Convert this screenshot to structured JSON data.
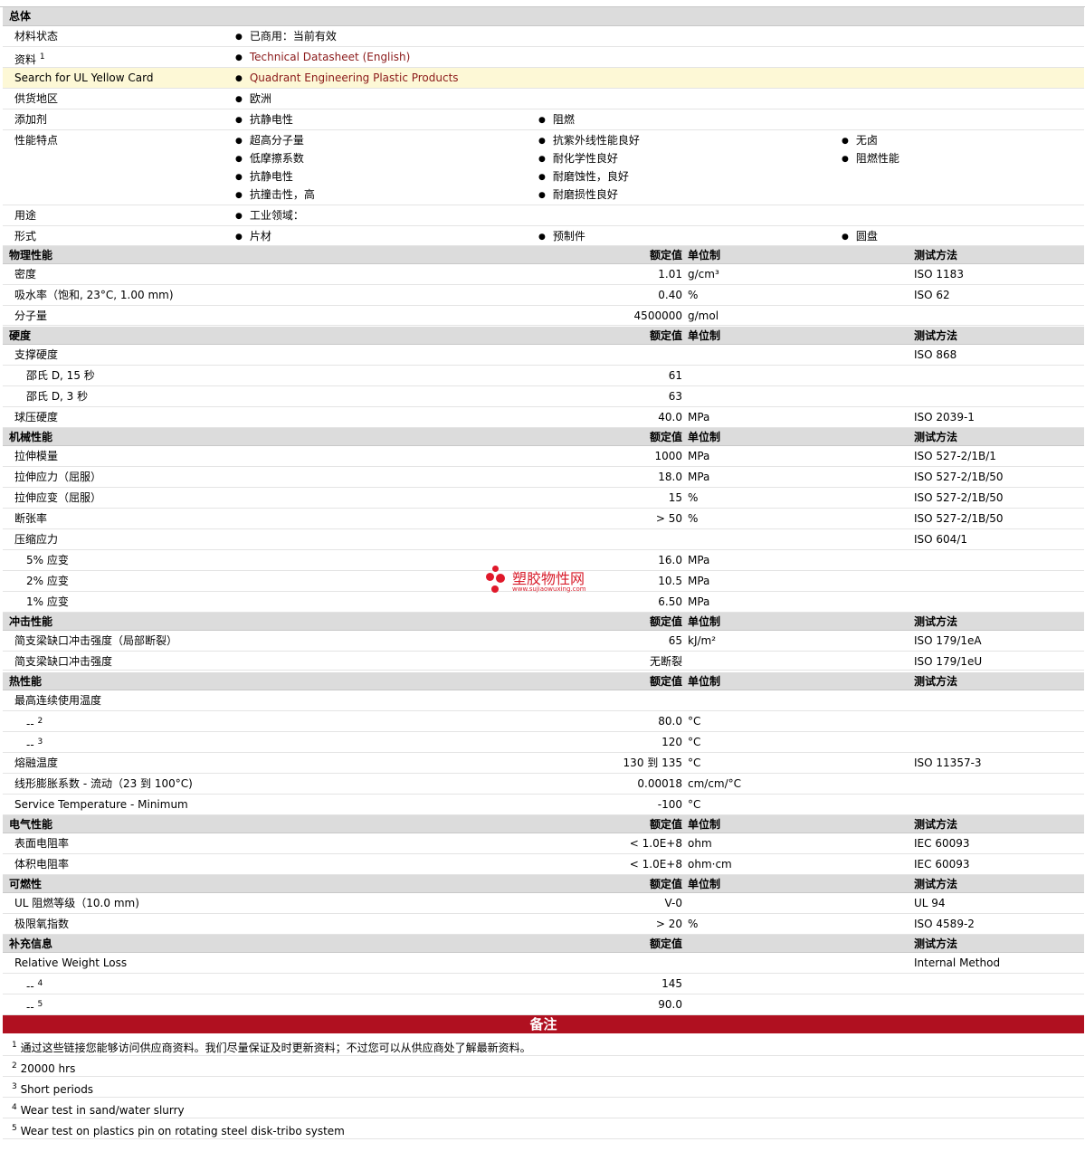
{
  "general": {
    "header": "总体",
    "status_label": "材料状态",
    "status_value": "已商用：当前有效",
    "docs_label": "资料",
    "docs_sup": "1",
    "docs_link": "Technical Datasheet (English)",
    "ul_label": "Search for UL Yellow Card",
    "ul_link": "Quadrant Engineering Plastic Products",
    "region_label": "供货地区",
    "region_value": "欧洲",
    "additive_label": "添加剂",
    "additives": [
      "抗静电性",
      "阻燃"
    ],
    "features_label": "性能特点",
    "features": [
      "超高分子量",
      "低摩擦系数",
      "抗静电性",
      "抗撞击性，高",
      "抗紫外线性能良好",
      "耐化学性良好",
      "耐磨蚀性，良好",
      "耐磨损性良好",
      "无卤",
      "阻燃性能"
    ],
    "use_label": "用途",
    "use_value": "工业领域：",
    "form_label": "形式",
    "forms": [
      "片材",
      "预制件",
      "圆盘"
    ]
  },
  "col_headers": {
    "value": "额定值",
    "unit": "单位制",
    "method": "测试方法"
  },
  "physical": {
    "header": "物理性能",
    "rows": [
      {
        "label": "密度",
        "value": "1.01",
        "unit": "g/cm³",
        "method": "ISO 1183"
      },
      {
        "label": "吸水率（饱和, 23°C, 1.00 mm)",
        "value": "0.40",
        "unit": "%",
        "method": "ISO 62"
      },
      {
        "label": "分子量",
        "value": "4500000",
        "unit": "g/mol",
        "method": ""
      }
    ]
  },
  "hardness": {
    "header": "硬度",
    "rows": [
      {
        "label": "支撑硬度",
        "value": "",
        "unit": "",
        "method": "ISO 868"
      },
      {
        "label": "邵氏 D, 15 秒",
        "value": "61",
        "unit": "",
        "method": ""
      },
      {
        "label": "邵氏 D, 3 秒",
        "value": "63",
        "unit": "",
        "method": ""
      },
      {
        "label": "球压硬度",
        "value": "40.0",
        "unit": "MPa",
        "method": "ISO 2039-1"
      }
    ]
  },
  "mechanical": {
    "header": "机械性能",
    "rows": [
      {
        "label": "拉伸模量",
        "value": "1000",
        "unit": "MPa",
        "method": "ISO 527-2/1B/1"
      },
      {
        "label": "拉伸应力（屈服）",
        "value": "18.0",
        "unit": "MPa",
        "method": "ISO 527-2/1B/50"
      },
      {
        "label": "拉伸应变（屈服）",
        "value": "15",
        "unit": "%",
        "method": "ISO 527-2/1B/50"
      },
      {
        "label": "断张率",
        "value": "> 50",
        "unit": "%",
        "method": "ISO 527-2/1B/50"
      },
      {
        "label": "压缩应力",
        "value": "",
        "unit": "",
        "method": "ISO 604/1"
      },
      {
        "label": "5% 应变",
        "value": "16.0",
        "unit": "MPa",
        "method": ""
      },
      {
        "label": "2% 应变",
        "value": "10.5",
        "unit": "MPa",
        "method": ""
      },
      {
        "label": "1% 应变",
        "value": "6.50",
        "unit": "MPa",
        "method": ""
      }
    ]
  },
  "impact": {
    "header": "冲击性能",
    "rows": [
      {
        "label": "简支梁缺口冲击强度（局部断裂）",
        "value": "65",
        "unit": "kJ/m²",
        "method": "ISO 179/1eA"
      },
      {
        "label": "简支梁缺口冲击强度",
        "value": "无断裂",
        "unit": "",
        "method": "ISO 179/1eU"
      }
    ]
  },
  "thermal": {
    "header": "热性能",
    "rows": [
      {
        "label": "最高连续使用温度",
        "value": "",
        "unit": "",
        "method": ""
      },
      {
        "label": "--",
        "sup": "2",
        "value": "80.0",
        "unit": "°C",
        "method": ""
      },
      {
        "label": "--",
        "sup": "3",
        "value": "120",
        "unit": "°C",
        "method": ""
      },
      {
        "label": "熔融温度",
        "value": "130 到  135",
        "unit": "°C",
        "method": "ISO 11357-3"
      },
      {
        "label": "线形膨胀系数 - 流动（23 到  100°C)",
        "value": "0.00018",
        "unit": "cm/cm/°C",
        "method": ""
      },
      {
        "label": "Service Temperature - Minimum",
        "value": "-100",
        "unit": "°C",
        "method": ""
      }
    ]
  },
  "electrical": {
    "header": "电气性能",
    "rows": [
      {
        "label": "表面电阻率",
        "value": "< 1.0E+8",
        "unit": "ohm",
        "method": "IEC 60093"
      },
      {
        "label": "体积电阻率",
        "value": "< 1.0E+8",
        "unit": "ohm·cm",
        "method": "IEC 60093"
      }
    ]
  },
  "flammability": {
    "header": "可燃性",
    "rows": [
      {
        "label": "UL 阻燃等级（10.0 mm)",
        "value": "V-0",
        "unit": "",
        "method": "UL 94"
      },
      {
        "label": "极限氧指数",
        "value": "> 20",
        "unit": "%",
        "method": "ISO 4589-2"
      }
    ]
  },
  "extra": {
    "header": "补充信息",
    "rows": [
      {
        "label": "Relative Weight Loss",
        "value": "",
        "unit": "",
        "method": "Internal Method"
      },
      {
        "label": "--",
        "sup": "4",
        "value": "145",
        "unit": "",
        "method": ""
      },
      {
        "label": "--",
        "sup": "5",
        "value": "90.0",
        "unit": "",
        "method": ""
      }
    ]
  },
  "notes": {
    "title": "备注",
    "items": [
      {
        "num": "1",
        "text": "通过这些链接您能够访问供应商资料。我们尽量保证及时更新资料；不过您可以从供应商处了解最新资料。"
      },
      {
        "num": "2",
        "text": "20000 hrs"
      },
      {
        "num": "3",
        "text": "Short periods"
      },
      {
        "num": "4",
        "text": "Wear test in sand/water slurry"
      },
      {
        "num": "5",
        "text": "Wear test on plastics pin on rotating steel disk-tribo system"
      }
    ]
  },
  "watermark": {
    "name": "塑胶物性网",
    "url": "www.sujiaowuxing.com",
    "color": "#d81e2c"
  },
  "colors": {
    "header_bg": "#dcdcdc",
    "highlight_bg": "#fdf8d6",
    "link": "#8b1a1a",
    "notes_bar": "#b01020"
  }
}
